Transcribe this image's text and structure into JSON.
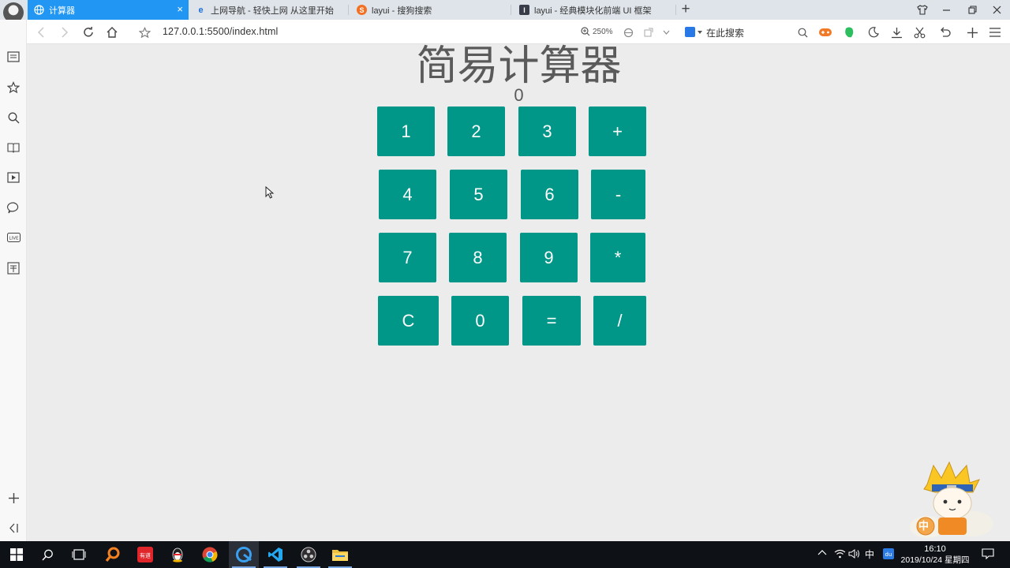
{
  "browser": {
    "tabs": [
      {
        "title": "计算器",
        "active": true
      },
      {
        "title": "上网导航 - 轻快上网 从这里开始",
        "active": false
      },
      {
        "title": "layui - 搜狗搜索",
        "active": false
      },
      {
        "title": "layui - 经典模块化前端 UI 框架",
        "active": false
      }
    ],
    "tab_close": "×",
    "new_tab": "+",
    "url": "127.0.0.1:5500/index.html",
    "zoom": "250%",
    "search_placeholder": "在此搜索"
  },
  "calculator": {
    "title": "简易计算器",
    "display": "0",
    "keys": [
      "1",
      "2",
      "3",
      "+",
      "4",
      "5",
      "6",
      "-",
      "7",
      "8",
      "9",
      "*",
      "C",
      "0",
      "=",
      "/"
    ]
  },
  "mascot": {
    "badge": "中"
  },
  "taskbar": {
    "ime": "中",
    "time": "16:10",
    "date": "2019/10/24 星期四"
  },
  "colors": {
    "key_bg": "#009688",
    "active_tab": "#2196f3",
    "page_bg": "#ececec"
  }
}
